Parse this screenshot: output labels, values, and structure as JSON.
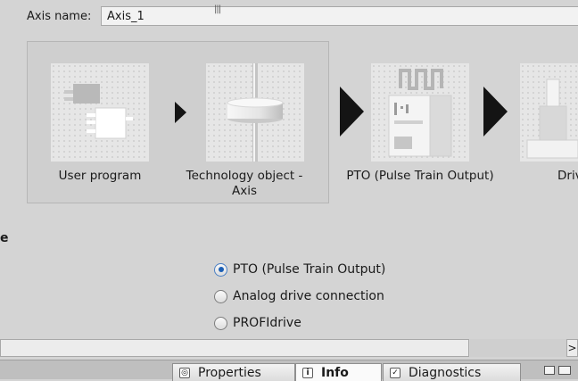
{
  "axis": {
    "label": "Axis name:",
    "value": "Axis_1"
  },
  "diagram": {
    "user_program": "User program",
    "tech_object": "Technology object - Axis",
    "pto": "PTO (Pulse Train Output)",
    "drive": "Drive"
  },
  "section": {
    "title": "e"
  },
  "options": [
    {
      "label": "PTO (Pulse Train Output)",
      "selected": true
    },
    {
      "label": "Analog drive connection",
      "selected": false
    },
    {
      "label": "PROFIdrive",
      "selected": false
    }
  ],
  "scrollbar": {
    "grip": "|||",
    "right_arrow": ">"
  },
  "bottom_tabs": [
    {
      "label": "Properties",
      "icon": "properties-icon"
    },
    {
      "label": "Info",
      "icon": "info-icon"
    },
    {
      "label": "Diagnostics",
      "icon": "diagnostics-icon"
    }
  ]
}
